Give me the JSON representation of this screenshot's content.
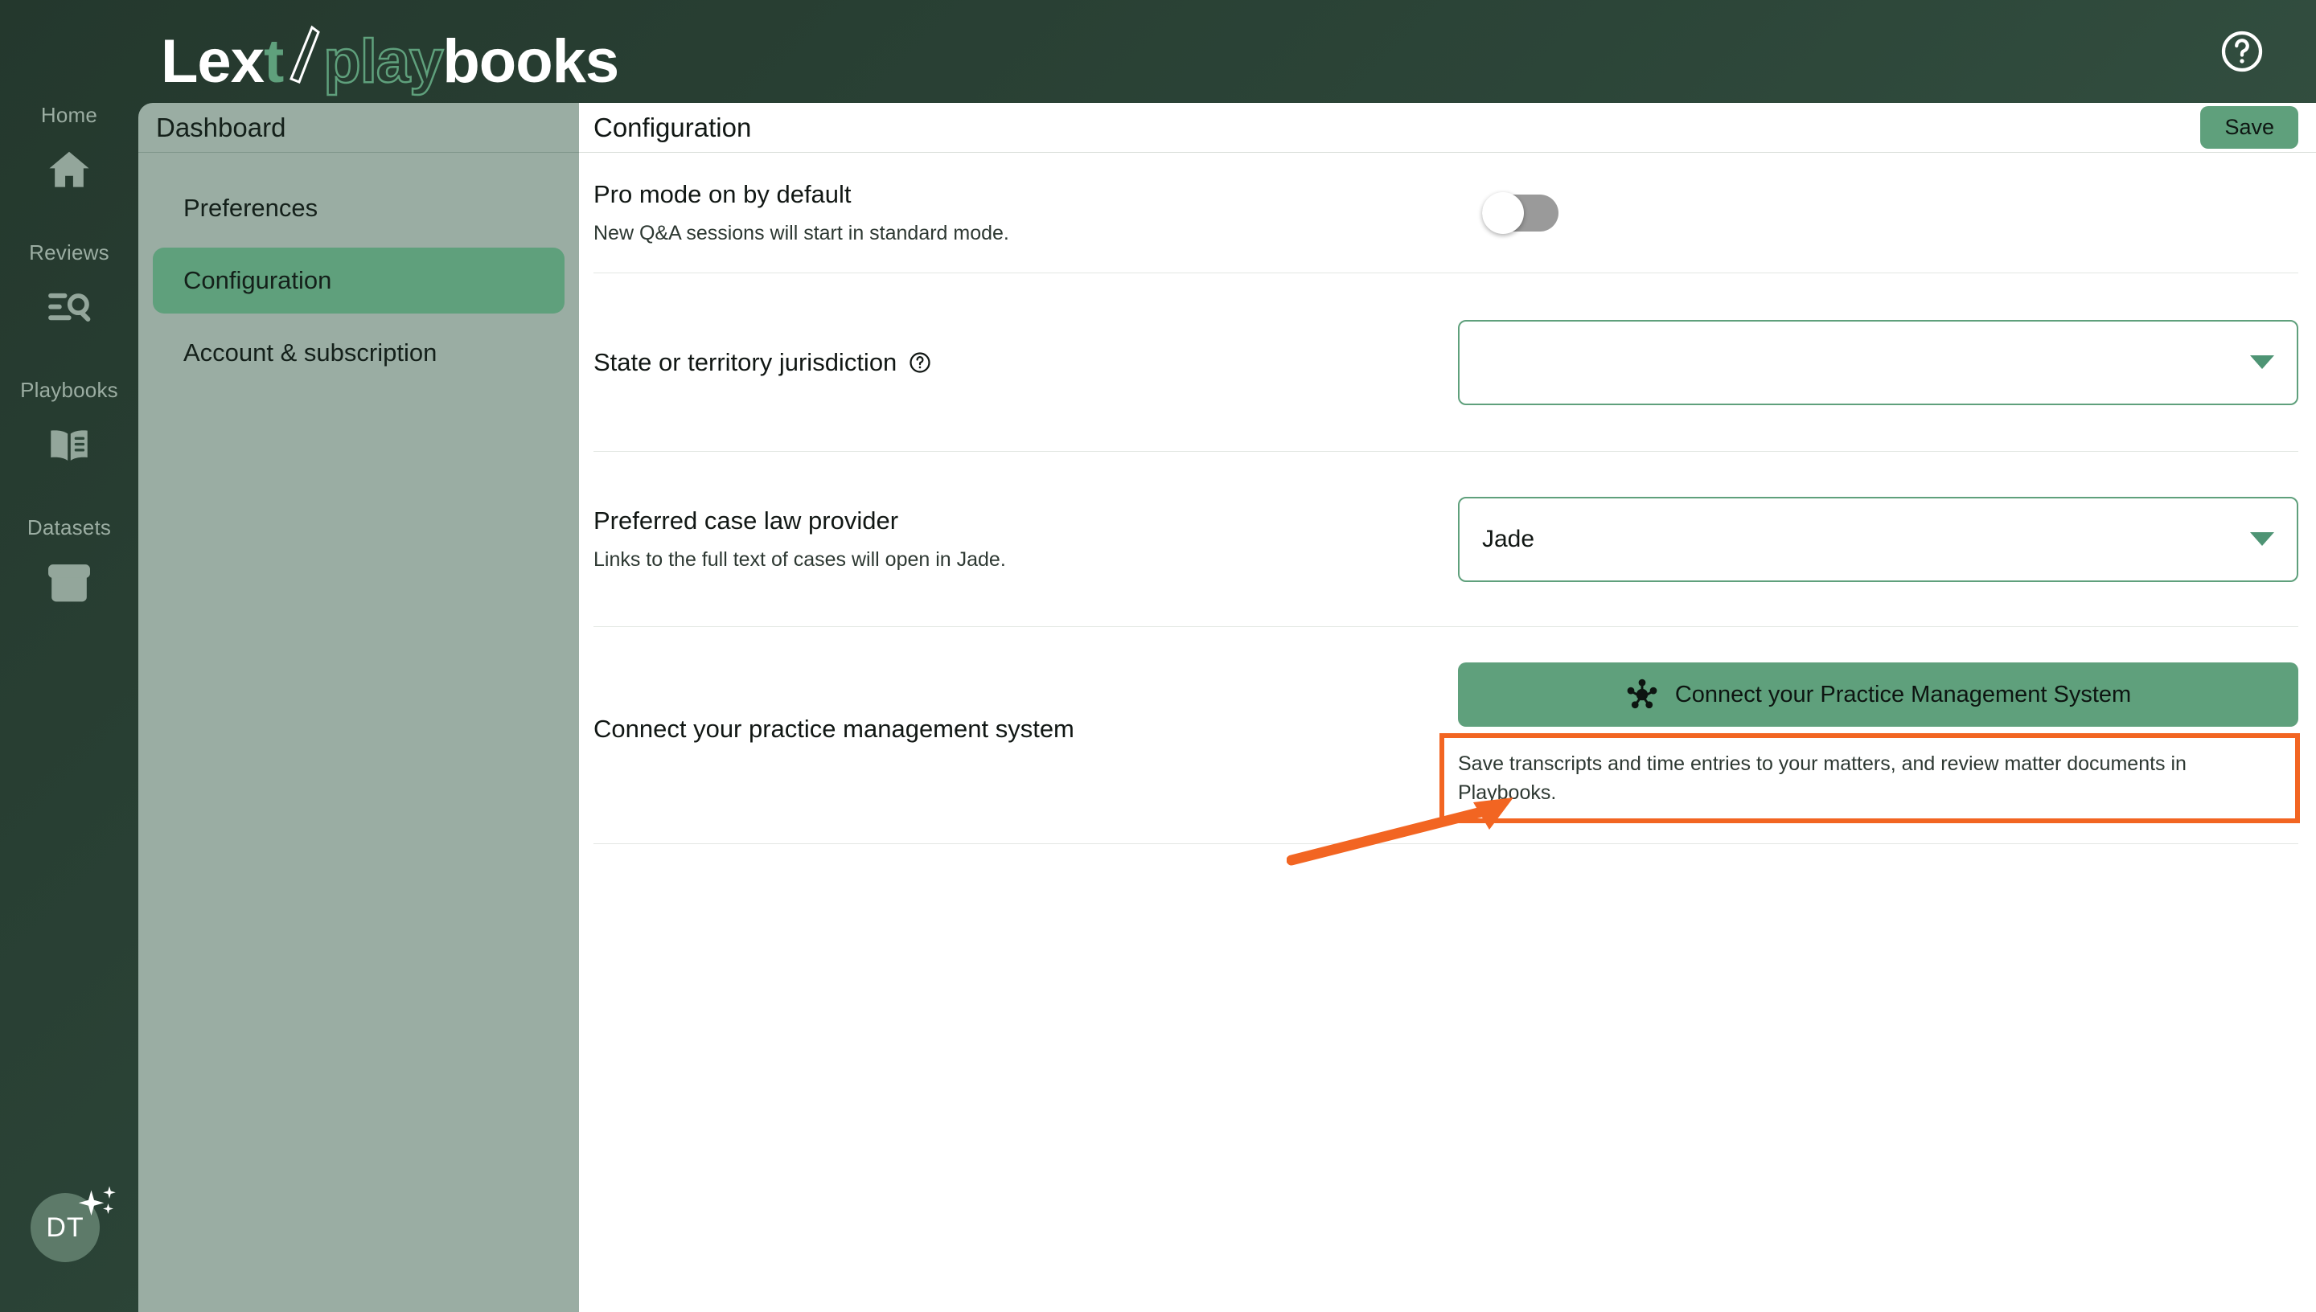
{
  "app": {
    "logo": {
      "part1": "Lex",
      "accent": "t",
      "part2": "play",
      "part3": "books",
      "full_text": "Lext/playbooks"
    },
    "help_icon": "help-circle-icon"
  },
  "rail": {
    "items": [
      {
        "label": "Home",
        "icon": "home-icon"
      },
      {
        "label": "Reviews",
        "icon": "document-search-icon"
      },
      {
        "label": "Playbooks",
        "icon": "open-book-icon"
      },
      {
        "label": "Datasets",
        "icon": "archive-box-icon"
      }
    ],
    "avatar": {
      "initials": "DT",
      "badge_icon": "sparkles-icon"
    }
  },
  "dashboard": {
    "header": "Dashboard",
    "items": [
      {
        "label": "Preferences",
        "active": false
      },
      {
        "label": "Configuration",
        "active": true
      },
      {
        "label": "Account & subscription",
        "active": false
      }
    ]
  },
  "content": {
    "title": "Configuration",
    "save_label": "Save",
    "rows": {
      "pro_mode": {
        "title": "Pro mode on by default",
        "subtitle": "New Q&A sessions will start in standard mode.",
        "toggle_state": "off"
      },
      "jurisdiction": {
        "title": "State or territory jurisdiction",
        "help_icon": "question-mark-circle-icon",
        "value": "",
        "placeholder": ""
      },
      "case_law": {
        "title": "Preferred case law provider",
        "subtitle": "Links to the full text of cases will open in Jade.",
        "value": "Jade"
      },
      "pms": {
        "title": "Connect your practice management system",
        "button_label": "Connect your Practice Management System",
        "button_icon": "hub-network-icon",
        "subtitle": "Save transcripts and time entries to your matters, and review matter documents in Playbooks."
      }
    }
  },
  "annotation": {
    "highlight_color": "#f26522",
    "target": "connect-your-practice-management-system-button"
  },
  "colors": {
    "brand_dark_green": "#2c4538",
    "brand_green": "#5fa07c",
    "panel_gray_green": "#9aada3",
    "content_bg": "#ffffff",
    "annotation_orange": "#f26522"
  }
}
